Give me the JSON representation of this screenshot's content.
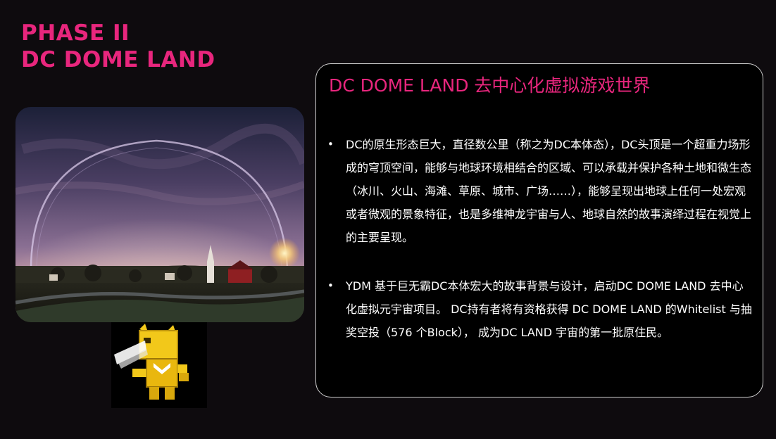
{
  "header": {
    "line1": "PHASE II",
    "line2": "DC DOME LAND"
  },
  "card": {
    "title": "DC DOME LAND 去中心化虚拟游戏世界",
    "bullets": [
      {
        "marker": "•",
        "text": "DC的原生形态巨大，直径数公里（称之为DC本体态），DC头顶是一个超重力场形成的穹顶空间，能够与地球环境相结合的区域、可以承载并保护各种土地和微生态（冰川、火山、海滩、草原、城市、广场……），能够呈现出地球上任何一处宏观或者微观的景象特征，也是多维神龙宇宙与人、地球自然的故事演绎过程在视觉上的主要呈现。"
      },
      {
        "marker": "•",
        "text": "YDM 基于巨无霸DC本体宏大的故事背景与设计，启动DC DOME LAND 去中心化虚拟元宇宙项目。 DC持有者将有资格获得 DC DOME LAND 的Whitelist 与抽奖空投（576 个Block）， 成为DC LAND 宇宙的第一批原住民。"
      }
    ]
  },
  "images": {
    "dome": "dome-landscape-image",
    "mascot": "yellow-robot-mascot"
  },
  "colors": {
    "accent_pink": "#e8267d",
    "background": "#0e0b0e",
    "card_border": "#cfcfcf",
    "text": "#ffffff",
    "mascot_yellow": "#f2c81a"
  }
}
